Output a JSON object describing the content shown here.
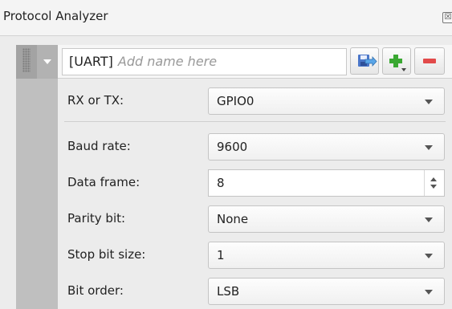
{
  "panel": {
    "title": "Protocol Analyzer",
    "close_glyph": "☒"
  },
  "decoder": {
    "type_tag": "[UART]",
    "name_placeholder": "Add name here",
    "name_value": "",
    "icons": {
      "save": "save-icon",
      "add": "add-plus-icon",
      "remove": "remove-minus-icon"
    }
  },
  "fields": {
    "rx_tx": {
      "label": "RX or TX:",
      "value": "GPIO0"
    },
    "baud_rate": {
      "label": "Baud rate:",
      "value": "9600"
    },
    "data_frame": {
      "label": "Data frame:",
      "value": "8"
    },
    "parity_bit": {
      "label": "Parity bit:",
      "value": "None"
    },
    "stop_bit_size": {
      "label": "Stop bit size:",
      "value": "1"
    },
    "bit_order": {
      "label": "Bit order:",
      "value": "LSB"
    }
  },
  "colors": {
    "add_green": "#3aa832",
    "remove_red": "#e24a4a",
    "save_blue": "#4a76c9"
  }
}
